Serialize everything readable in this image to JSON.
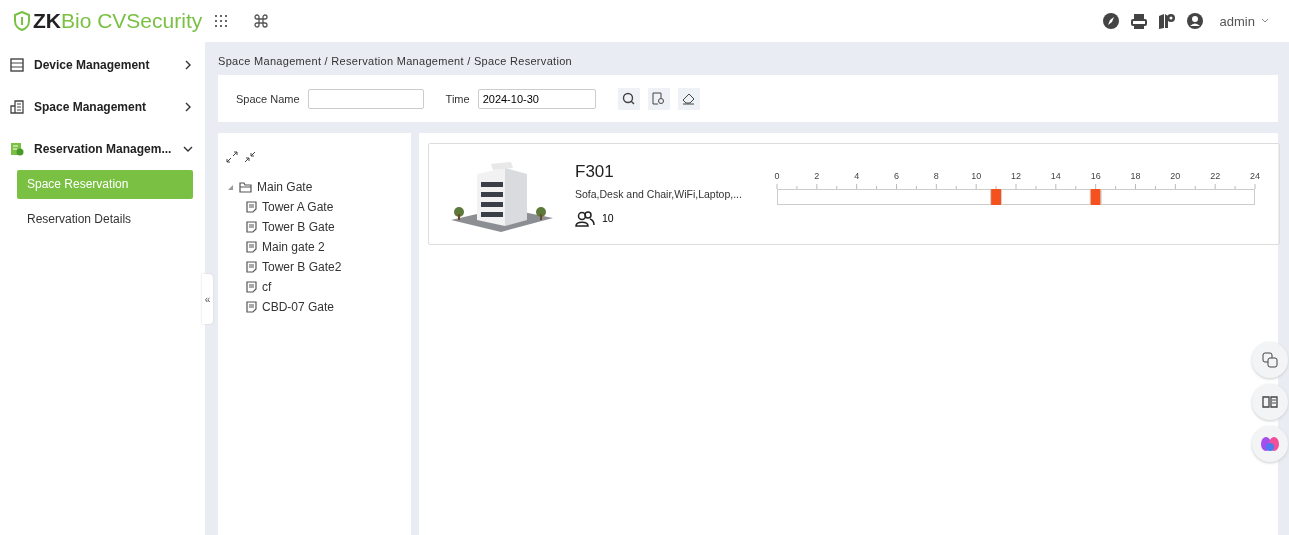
{
  "header": {
    "logo_prefix": "ZK",
    "logo_rest": "Bio CVSecurity",
    "user": "admin"
  },
  "sidebar": {
    "items": [
      {
        "label": "Device Management",
        "expanded": false
      },
      {
        "label": "Space Management",
        "expanded": false
      },
      {
        "label": "Reservation Managem...",
        "expanded": true,
        "children": [
          {
            "label": "Space Reservation",
            "selected": true
          },
          {
            "label": "Reservation Details",
            "selected": false
          }
        ]
      }
    ]
  },
  "breadcrumb": "Space Management / Reservation Management / Space Reservation",
  "search": {
    "fields": [
      {
        "label": "Space Name"
      },
      {
        "label": "Time",
        "value": "2024-10-30"
      }
    ]
  },
  "collapse_handle": "«",
  "tree": {
    "items": [
      {
        "label": "Main Gate",
        "expanded": true,
        "children": [
          {
            "label": "Tower A Gate"
          },
          {
            "label": "Tower B Gate"
          },
          {
            "label": "Main gate 2"
          },
          {
            "label": "Tower B Gate2"
          },
          {
            "label": "cf"
          },
          {
            "label": "CBD-07 Gate"
          }
        ]
      }
    ]
  },
  "spaces": [
    {
      "name": "F301",
      "amenities": "Sofa,Desk and Chair,WiFi,Laptop,...",
      "capacity": "10",
      "chart_data": {
        "type": "bar",
        "orientation": "horizontal",
        "stacked": true,
        "categories": [
          null
        ],
        "xlim": [
          0,
          24
        ],
        "xticks": [
          0,
          2,
          4,
          6,
          8,
          10,
          12,
          14,
          16,
          18,
          20,
          22,
          24
        ],
        "series": [
          {
            "color": "#ffffff",
            "values": [
              10.75
            ]
          },
          {
            "color": "#f4511e",
            "values": [
              0.5
            ]
          },
          {
            "color": "#ffffff",
            "values": [
              4.5
            ]
          },
          {
            "color": "#f4511e",
            "values": [
              0.5
            ]
          },
          {
            "color": "#ffffff",
            "values": [
              7.75
            ]
          }
        ]
      }
    }
  ]
}
